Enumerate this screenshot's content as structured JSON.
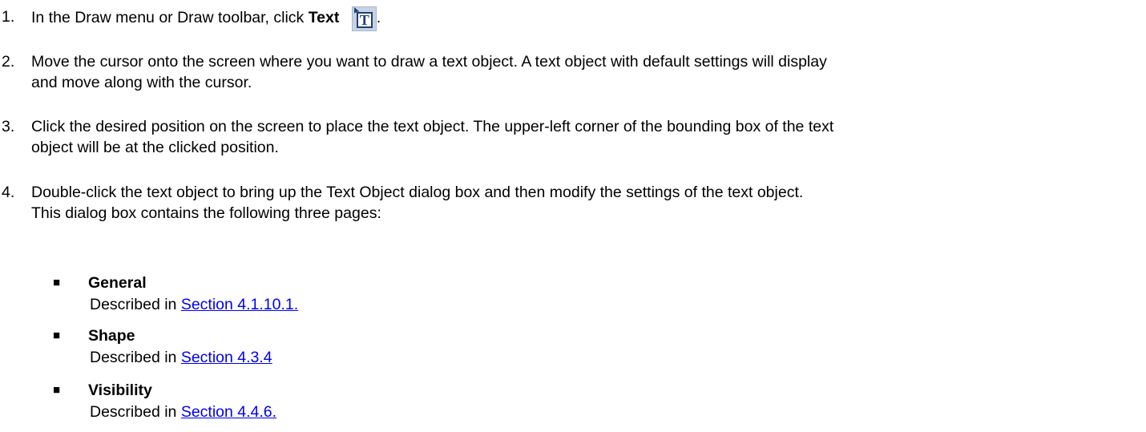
{
  "steps": [
    {
      "number": "1.",
      "text_before": "In the Draw menu or Draw toolbar, click ",
      "bold": "Text",
      "text_after": ".",
      "icon": "text-tool-icon",
      "icon_glyph": "T"
    },
    {
      "number": "2.",
      "line1": "Move the cursor onto the screen where you want to draw a text object. A text object with default settings will display",
      "line2": "and move along with the cursor."
    },
    {
      "number": "3.",
      "line1": "Click the desired position on the screen to place the text object. The upper-left corner of the bounding box of the text",
      "line2": "object will be at the clicked position."
    },
    {
      "number": "4.",
      "line1": "Double-click the text object to bring up the Text Object dialog box and then modify the settings of the text object.",
      "line2": "This dialog box contains the following three pages:"
    }
  ],
  "pages": [
    {
      "bullet": "■",
      "title": "General",
      "desc": "Described in ",
      "link": "Section 4.1.10.1."
    },
    {
      "bullet": "■",
      "title": "Shape",
      "desc": "Described in ",
      "link": "Section 4.3.4"
    },
    {
      "bullet": "■",
      "title": "Visibility",
      "desc": "Described in ",
      "link": "Section 4.4.6."
    }
  ],
  "colors": {
    "link": "#0000ee",
    "icon_bg": "#c7d3e4",
    "icon_border": "#1f3f77"
  }
}
